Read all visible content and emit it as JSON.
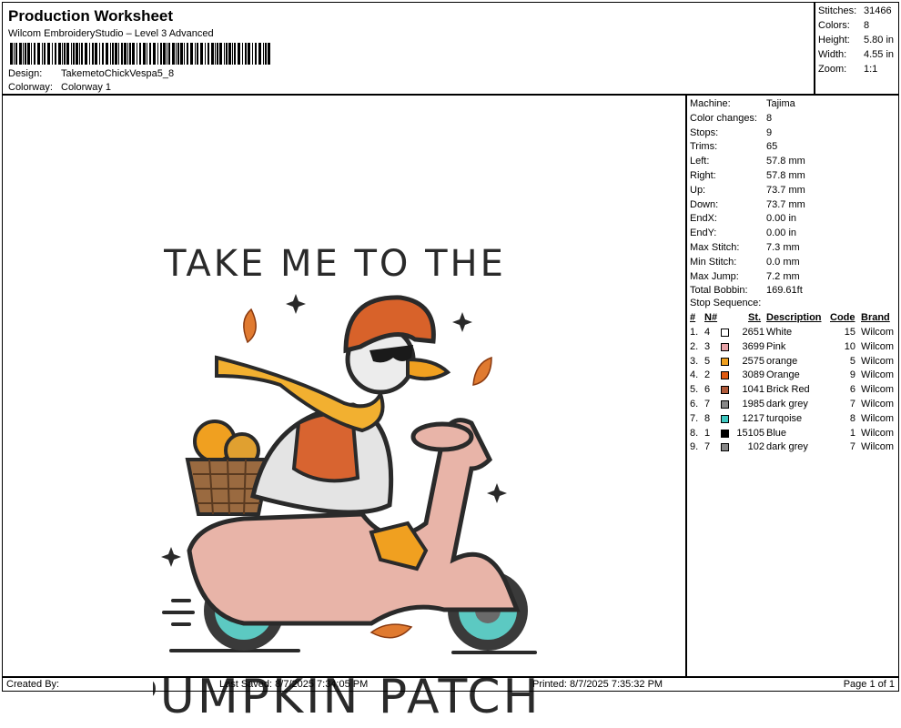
{
  "header": {
    "title": "Production Worksheet",
    "subtitle": "Wilcom EmbroideryStudio – Level 3 Advanced",
    "design_label": "Design:",
    "design_value": "TakemetoChickVespa5_8",
    "colorway_label": "Colorway:",
    "colorway_value": "Colorway 1"
  },
  "summary": {
    "rows": [
      {
        "k": "Stitches:",
        "v": "31466"
      },
      {
        "k": "Colors:",
        "v": "8"
      },
      {
        "k": "Height:",
        "v": "5.80 in"
      },
      {
        "k": "Width:",
        "v": "4.55 in"
      },
      {
        "k": "Zoom:",
        "v": "1:1"
      }
    ]
  },
  "artwork": {
    "top_text": "TAKE ME TO THE",
    "bottom_text": "PUMPKIN PATCH"
  },
  "details": {
    "rows": [
      {
        "k": "Machine:",
        "v": "Tajima"
      },
      {
        "k": "Color changes:",
        "v": "8"
      },
      {
        "k": "Stops:",
        "v": "9"
      },
      {
        "k": "Trims:",
        "v": "65"
      },
      {
        "k": "Left:",
        "v": "57.8 mm"
      },
      {
        "k": "Right:",
        "v": "57.8 mm"
      },
      {
        "k": "Up:",
        "v": "73.7 mm"
      },
      {
        "k": "Down:",
        "v": "73.7 mm"
      },
      {
        "k": "EndX:",
        "v": "0.00 in"
      },
      {
        "k": "EndY:",
        "v": "0.00 in"
      },
      {
        "k": "Max Stitch:",
        "v": "7.3 mm"
      },
      {
        "k": "Min Stitch:",
        "v": "0.0 mm"
      },
      {
        "k": "Max Jump:",
        "v": "7.2 mm"
      },
      {
        "k": "Total Bobbin:",
        "v": "169.61ft"
      }
    ]
  },
  "stop_sequence": {
    "label": "Stop Sequence:",
    "headers": {
      "idx": "#",
      "n": "N#",
      "st": "St.",
      "desc": "Description",
      "code": "Code",
      "brand": "Brand"
    },
    "rows": [
      {
        "idx": "1.",
        "n": "4",
        "color": "#ffffff",
        "st": "2651",
        "desc": "White",
        "code": "15",
        "brand": "Wilcom"
      },
      {
        "idx": "2.",
        "n": "3",
        "color": "#e8a3a8",
        "st": "3699",
        "desc": "Pink",
        "code": "10",
        "brand": "Wilcom"
      },
      {
        "idx": "3.",
        "n": "5",
        "color": "#f0a020",
        "st": "2575",
        "desc": "orange",
        "code": "5",
        "brand": "Wilcom"
      },
      {
        "idx": "4.",
        "n": "2",
        "color": "#e05a10",
        "st": "3089",
        "desc": "Orange",
        "code": "9",
        "brand": "Wilcom"
      },
      {
        "idx": "5.",
        "n": "6",
        "color": "#b05a3a",
        "st": "1041",
        "desc": "Brick Red",
        "code": "6",
        "brand": "Wilcom"
      },
      {
        "idx": "6.",
        "n": "7",
        "color": "#888888",
        "st": "1985",
        "desc": "dark grey",
        "code": "7",
        "brand": "Wilcom"
      },
      {
        "idx": "7.",
        "n": "8",
        "color": "#3ec7c0",
        "st": "1217",
        "desc": "turqoise",
        "code": "8",
        "brand": "Wilcom"
      },
      {
        "idx": "8.",
        "n": "1",
        "color": "#000000",
        "st": "15105",
        "desc": "Blue",
        "code": "1",
        "brand": "Wilcom"
      },
      {
        "idx": "9.",
        "n": "7",
        "color": "#888888",
        "st": "102",
        "desc": "dark grey",
        "code": "7",
        "brand": "Wilcom"
      }
    ]
  },
  "footer": {
    "created": "Created By:",
    "saved": "Last Saved: 8/7/2025 7:34:05 PM",
    "printed": "Printed: 8/7/2025 7:35:32 PM",
    "page": "Page 1 of 1"
  }
}
